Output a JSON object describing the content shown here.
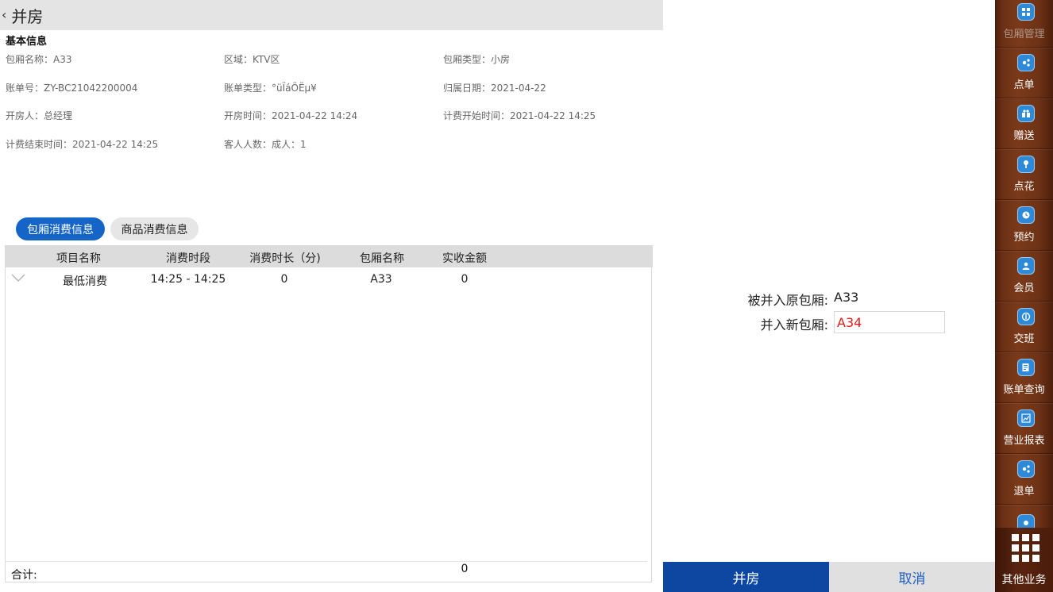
{
  "header": {
    "title": "并房"
  },
  "basic_info": {
    "section_title": "基本信息",
    "items": [
      {
        "label": "包厢名称：",
        "value": "A33"
      },
      {
        "label": "区域：",
        "value": "KTV区"
      },
      {
        "label": "包厢类型：",
        "value": "小房"
      },
      {
        "label": "账单号：",
        "value": "ZY-BC21042200004"
      },
      {
        "label": "账单类型：",
        "value": "°üÏáÕËµ¥"
      },
      {
        "label": "归属日期：",
        "value": "2021-04-22"
      },
      {
        "label": "开房人：",
        "value": "总经理"
      },
      {
        "label": "开房时间：",
        "value": "2021-04-22 14:24"
      },
      {
        "label": "计费开始时间：",
        "value": "2021-04-22 14:25"
      },
      {
        "label": "计费结束时间：",
        "value": "2021-04-22 14:25"
      },
      {
        "label": "客人人数：",
        "value": "成人：1"
      }
    ]
  },
  "tabs": [
    {
      "label": "包厢消费信息",
      "active": true
    },
    {
      "label": "商品消费信息",
      "active": false
    }
  ],
  "table": {
    "columns": [
      "项目名称",
      "消费时段",
      "消费时长（分)",
      "包厢名称",
      "实收金额"
    ],
    "rows": [
      [
        "最低消费",
        "14:25 - 14:25",
        "0",
        "A33",
        "0"
      ]
    ],
    "total_label": "合计:",
    "total_value": "0"
  },
  "merge": {
    "orig_label": "被并入原包厢:",
    "orig_value": "A33",
    "new_label": "并入新包厢:",
    "new_value": "A34"
  },
  "actions": {
    "confirm": "并房",
    "cancel": "取消"
  },
  "sidebar": {
    "items": [
      {
        "label": "包厢管理",
        "icon": "grid-list-icon",
        "active": true
      },
      {
        "label": "点单",
        "icon": "order-icon",
        "active": false
      },
      {
        "label": "赠送",
        "icon": "gift-icon",
        "active": false
      },
      {
        "label": "点花",
        "icon": "flower-icon",
        "active": false
      },
      {
        "label": "预约",
        "icon": "reserve-icon",
        "active": false
      },
      {
        "label": "会员",
        "icon": "member-icon",
        "active": false
      },
      {
        "label": "交班",
        "icon": "shift-icon",
        "active": false
      },
      {
        "label": "账单查询",
        "icon": "bill-search-icon",
        "active": false
      },
      {
        "label": "营业报表",
        "icon": "report-icon",
        "active": false
      },
      {
        "label": "退单",
        "icon": "refund-icon",
        "active": false
      }
    ],
    "more_label": "其他业务"
  },
  "colors": {
    "primary": "#1565c8",
    "confirm_bg": "#0d47a1",
    "highlight_text": "#e31b1b",
    "sidebar_wood": "#7b3a1a"
  }
}
